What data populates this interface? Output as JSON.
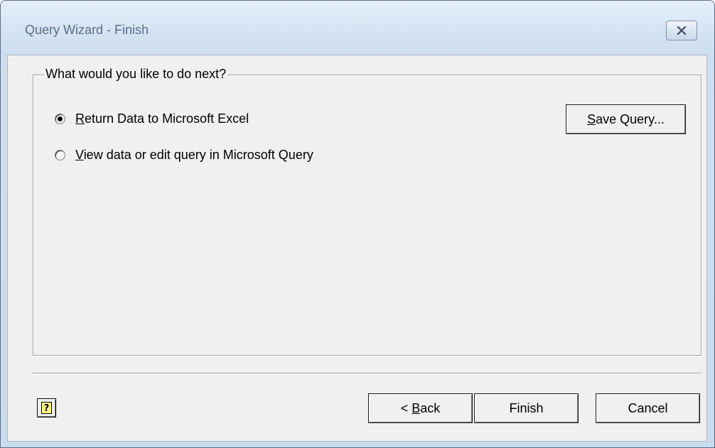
{
  "window": {
    "title": "Query Wizard - Finish"
  },
  "group": {
    "legend": "What would you like to do next?"
  },
  "options": [
    {
      "accel": "R",
      "rest": "eturn Data to Microsoft Excel",
      "checked": true
    },
    {
      "accel": "V",
      "rest": "iew data or edit query in Microsoft Query",
      "checked": false
    }
  ],
  "buttons": {
    "save_query": {
      "accel": "S",
      "rest": "ave Query..."
    },
    "back": {
      "prefix": "< ",
      "accel": "B",
      "rest": "ack"
    },
    "finish": "Finish",
    "cancel": "Cancel",
    "help_glyph": "?"
  },
  "icons": {
    "close": "close-icon",
    "help": "help-icon"
  },
  "colors": {
    "title_text": "#5c6f86",
    "dialog_bg": "#f0f0f0",
    "help_icon_bg": "#ffff80"
  }
}
